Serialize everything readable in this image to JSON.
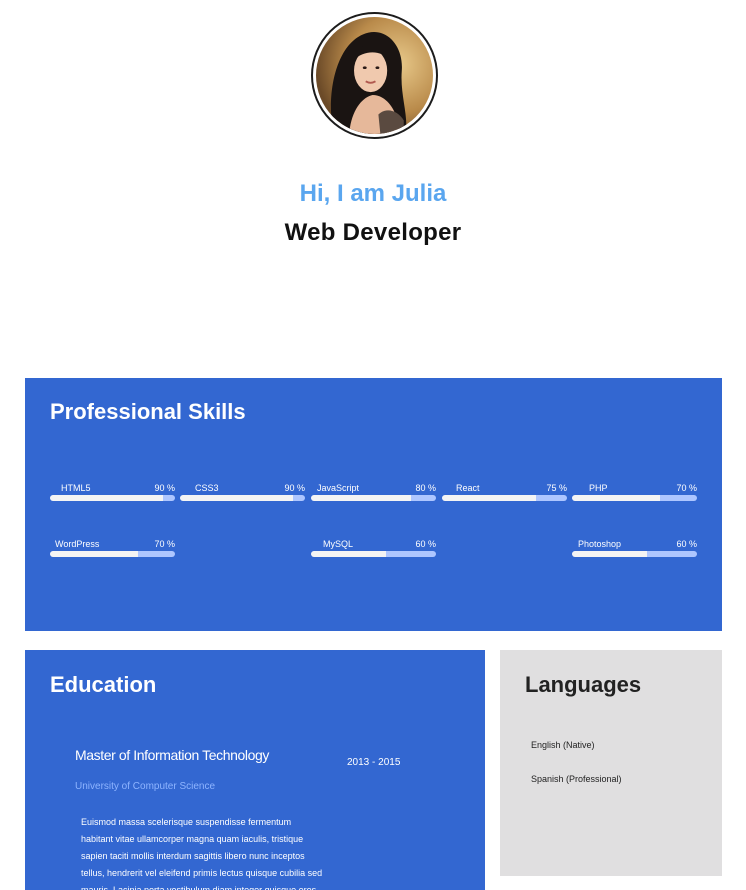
{
  "profile": {
    "greeting": "Hi, I am Julia",
    "role": "Web Developer"
  },
  "skills": {
    "title": "Professional Skills",
    "items": [
      {
        "name": "HTML5",
        "percent_label": "90 %",
        "level": 0.9
      },
      {
        "name": "CSS3",
        "percent_label": "90 %",
        "level": 0.9
      },
      {
        "name": "JavaScript",
        "percent_label": "80 %",
        "level": 0.8
      },
      {
        "name": "React",
        "percent_label": "75 %",
        "level": 0.75
      },
      {
        "name": "PHP",
        "percent_label": "70 %",
        "level": 0.7
      },
      {
        "name": "WordPress",
        "percent_label": "70 %",
        "level": 0.7
      },
      {
        "name": "MySQL",
        "percent_label": "60 %",
        "level": 0.6
      },
      {
        "name": "Photoshop",
        "percent_label": "60 %",
        "level": 0.6
      }
    ]
  },
  "education": {
    "title": "Education",
    "degree": "Master of Information Technology",
    "years": "2013 - 2015",
    "school": "University of Computer Science",
    "description": "Euismod massa scelerisque suspendisse fermentum habitant vitae ullamcorper magna quam iaculis, tristique sapien taciti mollis interdum sagittis libero nunc inceptos tellus, hendrerit vel eleifend primis lectus quisque cubilia sed mauris. Lacinia porta vestibulum diam integer quisque eros"
  },
  "languages": {
    "title": "Languages",
    "items": [
      "English (Native)",
      "Spanish (Professional)"
    ]
  },
  "colors": {
    "panel_blue": "#3367d1",
    "greeting_blue": "#5aa6ef",
    "languages_gray": "#e0dfe0"
  }
}
